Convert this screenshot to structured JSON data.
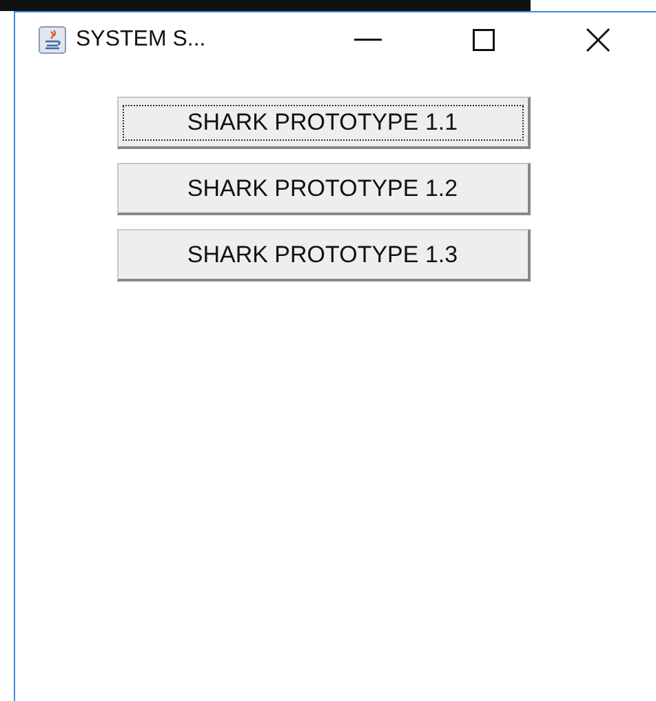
{
  "window": {
    "title": "SYSTEM S..."
  },
  "buttons": [
    {
      "label": "SHARK PROTOTYPE 1.1",
      "focused": true
    },
    {
      "label": "SHARK PROTOTYPE 1.2",
      "focused": false
    },
    {
      "label": "SHARK PROTOTYPE 1.3",
      "focused": false
    }
  ]
}
